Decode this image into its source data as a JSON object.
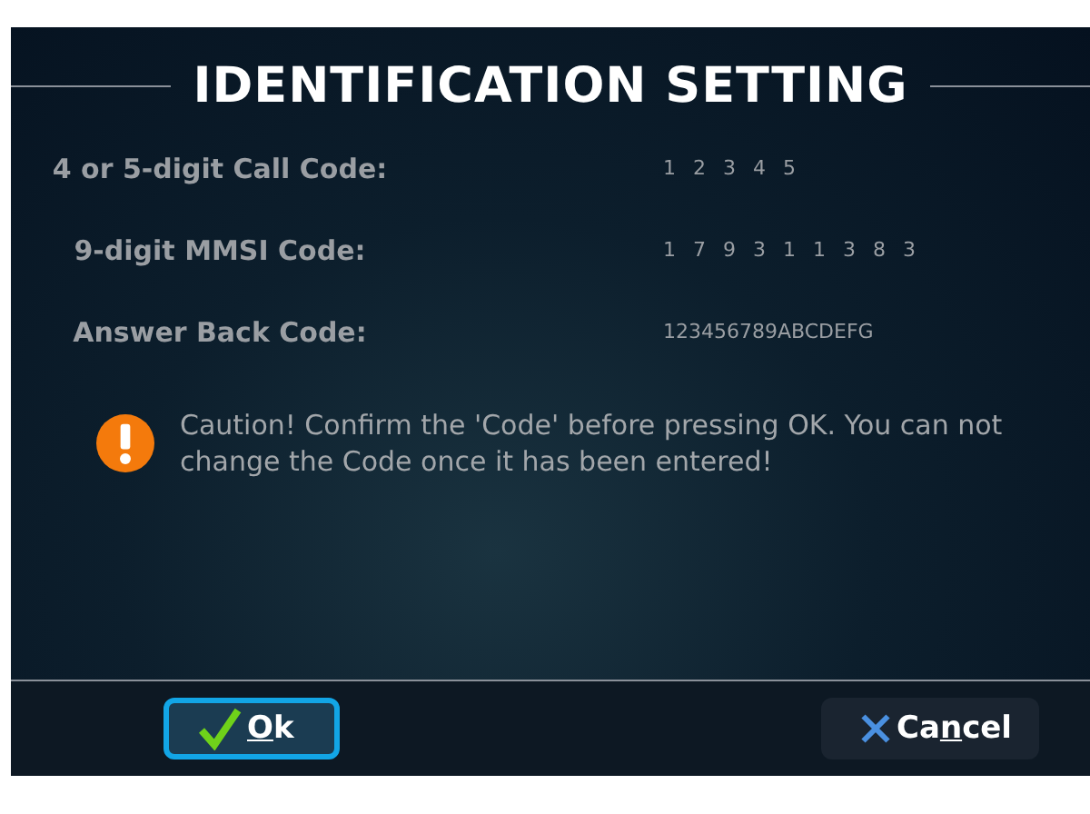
{
  "dialog": {
    "title": "IDENTIFICATION SETTING",
    "fields": [
      {
        "label": "4 or 5-digit Call Code:",
        "value": "1 2 3 4 5"
      },
      {
        "label": "9-digit MMSI Code:",
        "value": "1 7 9 3 1 1 3 8 3"
      },
      {
        "label": "Answer Back Code:",
        "value": "123456789ABCDEFG"
      }
    ],
    "caution": "Caution!  Confirm the 'Code' before pressing OK. You can not change the Code once it has been entered!",
    "buttons": [
      {
        "kind": "ok",
        "mnemonic": "O",
        "label_after": "k",
        "focused": true
      },
      {
        "kind": "cancel",
        "label_before": "Ca",
        "mnemonic": "n",
        "label_after": "cel",
        "focused": false
      }
    ]
  }
}
